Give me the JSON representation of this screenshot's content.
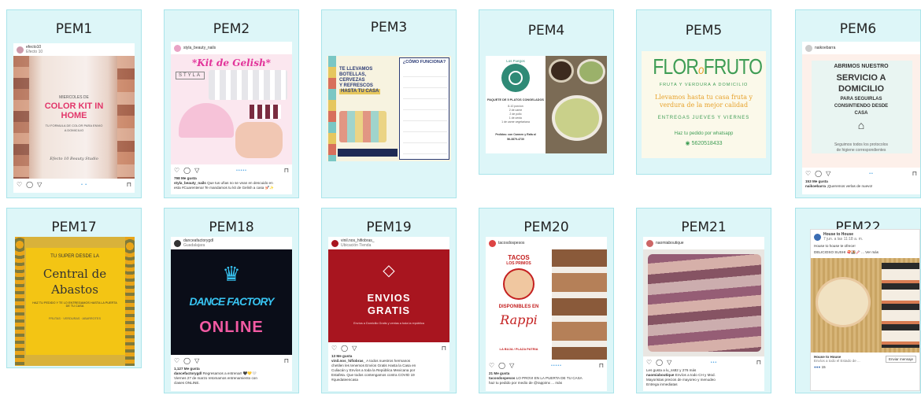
{
  "cards": [
    {
      "label": "PEM1",
      "post": {
        "user": "efecto10",
        "sub": "Efecto 10",
        "img_lines": [
          "MIERCOLES DE",
          "COLOR KIT IN",
          "HOME",
          "TU FORMULA DE COLOR PARA ENVIO",
          "A DOMICILIO",
          "Efecto 10 Beauty Studio"
        ]
      }
    },
    {
      "label": "PEM2",
      "post": {
        "user": "styla_beauty_nails",
        "img_title": "*Kit de Gelish*",
        "brand": "STYLA",
        "likes": "798 Me gusta",
        "caption_user": "styla_beauty_nails",
        "caption": "Que tus uñas no se vean en descuido en",
        "caption2": "esta #Cuarentena! Te mandamos tu kit de Gelish a casa 💅🏻✨"
      }
    },
    {
      "label": "PEM3",
      "post": {
        "left_lines": [
          "TE LLEVAMOS",
          "BOTELLAS,",
          "CERVEZAS",
          "Y REFRESCOS",
          "HASTA TU CASA"
        ],
        "right_title": "¿CÓMO FUNCIONA?"
      }
    },
    {
      "label": "PEM4",
      "post": {
        "brand": "Los Fuegos",
        "pkg_title": "PAQUETE DE 5 PLATOS CONGELADOS",
        "lines": [
          "8-10 porcion",
          "2 de carne",
          "2 de pollo",
          "1 de cerdo",
          "1 de carne vegetariana"
        ],
        "foot": "Pedidos: con Carmen y Rafa al",
        "phone": "56-3879-4730"
      }
    },
    {
      "label": "PEM5",
      "post": {
        "title_a": "FLOR",
        "title_o": "o",
        "title_b": "FRUTO",
        "subtitle": "FRUTA Y VERDURA A DOMICILIO",
        "line1": "Llevamos hasta tu casa fruta y",
        "line2": "verdura de la mejor calidad",
        "line3": "ENTREGAS JUEVES Y VIERNES",
        "line4": "Haz tu pedido por whatsapp",
        "phone": "5620518433"
      }
    },
    {
      "label": "PEM6",
      "post": {
        "user": "naikoebarra",
        "l1": "ABRIMOS NUESTRO",
        "l2": "SERVICIO A",
        "l3": "DOMICILIO",
        "l4": "PARA SEGUIRLAS",
        "l5": "CONSINTIENDO DESDE",
        "l6": "CASA",
        "l7": "Seguimos todos los protocolos",
        "l8": "de higiene correspondientes",
        "likes": "153 Me gusta",
        "caption_user": "naikoebarra",
        "caption": "¡Queremos verlas de nuevo!"
      }
    },
    {
      "label": "PEM17",
      "post": {
        "l1": "TU SUPER DESDE LA",
        "l2": "Central de",
        "l3": "Abastos",
        "l4": "HAZ TU PEDIDO Y TE LO ENTREGAMOS HASTA LA PUERTA DE TU CASA",
        "l5": "FRUTAS · VERDURAS · ABARROTES"
      }
    },
    {
      "label": "PEM18",
      "post": {
        "user": "danceafactorygdl",
        "sub": "Guadalajara",
        "l1": "DANCE FACTORY",
        "l2": "ONLINE",
        "likes": "1,127 Me gusta",
        "caption_user": "dancefactorygdl",
        "caption": "Regresamos a entrenar! 🖤💛🤍",
        "caption2": "Viernes 27 de marzo retomamos entrenamiento con",
        "caption3": "clases ONLINE."
      }
    },
    {
      "label": "PEM19",
      "post": {
        "user": "vinil.nos_hifiobras_",
        "sub": "Ubicación Tienda",
        "l1": "ENVIOS",
        "l2": "GRATIS",
        "l3": "Envíos a Domicilio Gratis y ventas a toda la república",
        "likes": "13 Me gusta",
        "caption_user": "vinil.nos_hifiobras_",
        "caption": "A todos nuestros hermanos",
        "caption2": "chetilen les tenemos Envíos Gratis Hasta la Casa en",
        "caption3": "Culiacán y Envíos a toda la República Mexicana por",
        "caption4": "Estafeta. Que todos contengamos contra COVID 19",
        "caption5": "#quedateencasa"
      }
    },
    {
      "label": "PEM20",
      "post": {
        "user": "tacosdospesos",
        "l1": "TACOS",
        "l2": "LOS PRIMOS",
        "l3": "DISPONIBLES EN",
        "l4": "Rappi",
        "l5": "LA BUJA / PLAZA PATRIA",
        "likes": "21 Me gusta",
        "caption_user": "tacosdospesos",
        "caption": "LO PROVI EN LA PUERTA DE TU CASA",
        "caption2": "haz tu pedido por medio de @rappimx ... más"
      }
    },
    {
      "label": "PEM21",
      "post": {
        "user": "naomiaboutique",
        "likes": "Les gusta a lu_ss82 y 276 más",
        "caption_user": "naomiaboutique",
        "caption": "Envíos a todo CH y Mod.",
        "caption2": "Mayoristas precios de mayoreo y menudeo",
        "caption3": "Entrega inmediatas"
      }
    },
    {
      "label": "PEM22",
      "post": {
        "user": "House to House",
        "sub": "7 jun. a las 11:18 a. m.",
        "line": "House to house te ofrece!",
        "line2": "DELICIOSO SUSHI 🍣🍱🥢 ... Ver más",
        "likes": "15",
        "foot_name": "House to House",
        "foot_sub": "Envíos a todo el Estado de ...",
        "btn": "Enviar mensaje"
      }
    }
  ],
  "colors": {
    "card_bg": "#ddf6f8",
    "card_border": "#a9e4ea",
    "pem5_green": "#3f9d55",
    "pem17_yellow": "#f3c514",
    "pem19_red": "#a8151f"
  }
}
